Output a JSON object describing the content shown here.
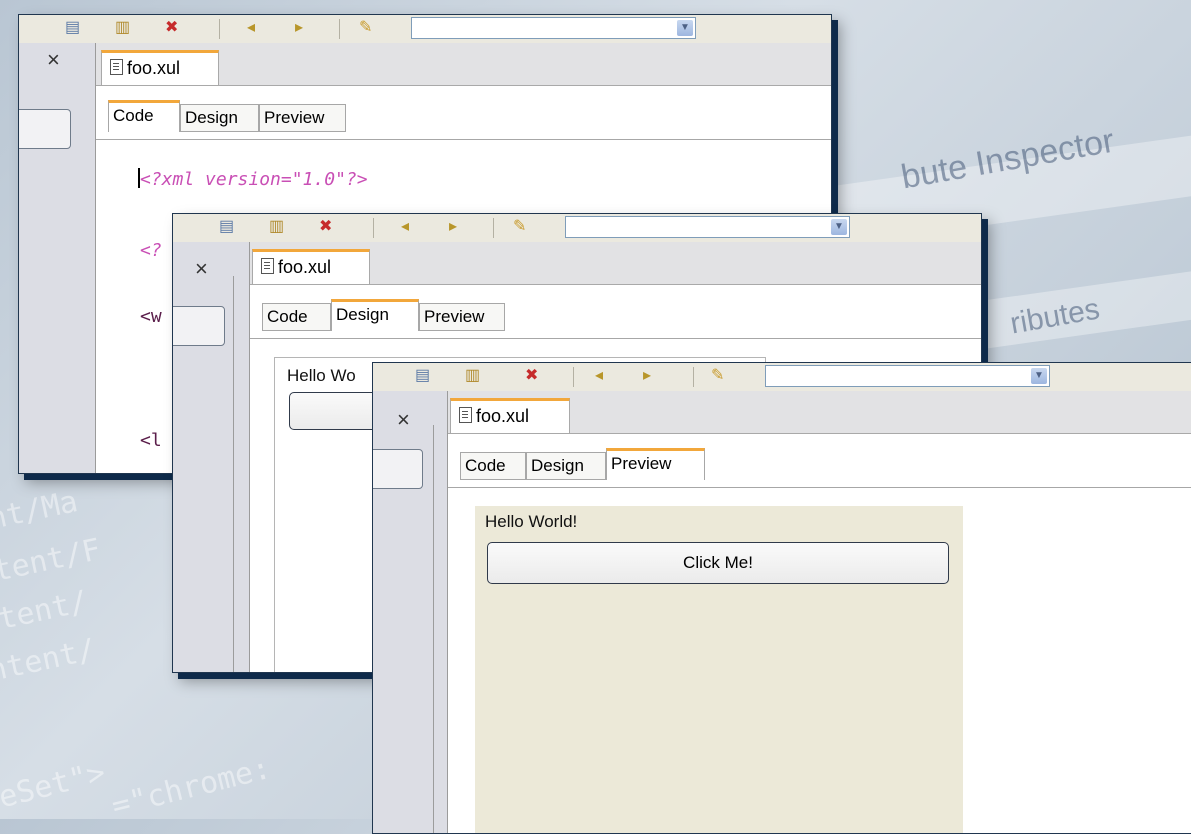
{
  "background": {
    "code_fragments": [
      "ent/Ma",
      "ntent/F",
      "ntent/",
      "ontent/",
      "leSet\">",
      "=\"chrome:"
    ],
    "ui_fragments": [
      "bute Inspector",
      "ributes"
    ]
  },
  "windows": [
    {
      "id": "code-view",
      "toolbar": {
        "icons": [
          "view-icon",
          "split-icon",
          "delete-icon",
          "arrow-left-icon",
          "arrow-right-icon",
          "pencil-icon"
        ]
      },
      "doc_tab": "foo.xul",
      "subtabs": [
        "Code",
        "Design",
        "Preview"
      ],
      "active_subtab": "Code",
      "code_lines": [
        "<?xml version=\"1.0\"?>",
        "<?",
        "<w",
        "<l"
      ]
    },
    {
      "id": "design-view",
      "toolbar": {
        "icons": [
          "view-icon",
          "split-icon",
          "delete-icon",
          "arrow-left-icon",
          "arrow-right-icon",
          "pencil-icon"
        ]
      },
      "doc_tab": "foo.xul",
      "subtabs": [
        "Code",
        "Design",
        "Preview"
      ],
      "active_subtab": "Design",
      "design_label": "Hello Wo"
    },
    {
      "id": "preview-view",
      "toolbar": {
        "icons": [
          "view-icon",
          "split-icon",
          "delete-icon",
          "arrow-left-icon",
          "arrow-right-icon",
          "pencil-icon"
        ]
      },
      "doc_tab": "foo.xul",
      "subtabs": [
        "Code",
        "Design",
        "Preview"
      ],
      "active_subtab": "Preview",
      "preview_label": "Hello World!",
      "preview_button": "Click Me!"
    }
  ],
  "close_glyph": "×",
  "colors": {
    "accent_tab": "#f2a73b",
    "code_pi": "#c94fb5",
    "window_shadow": "#0e2a4a",
    "preview_bg": "#ece9d8"
  }
}
